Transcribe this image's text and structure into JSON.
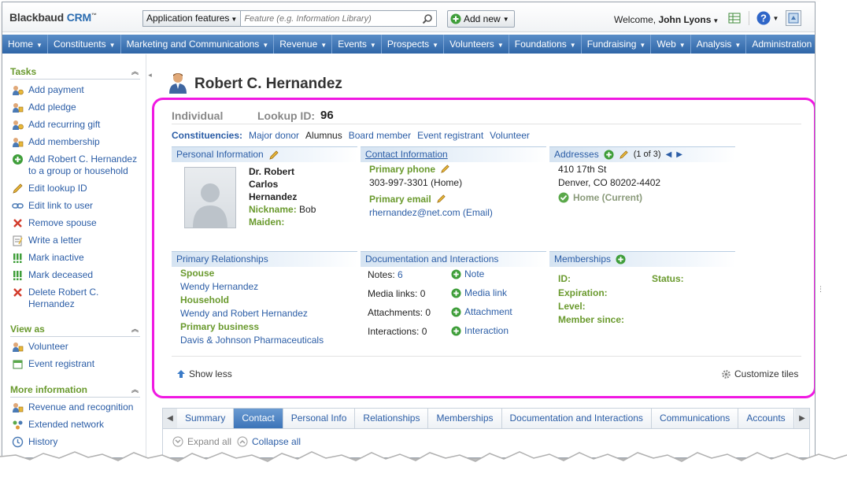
{
  "header": {
    "logo_brand": "Blackbaud",
    "logo_product": "CRM",
    "logo_tm": "™",
    "search_scope": "Application features",
    "search_placeholder": "Feature (e.g. Information Library)",
    "add_new": "Add new",
    "welcome_prefix": "Welcome,",
    "user_name": "John Lyons"
  },
  "nav": {
    "items": [
      "Home",
      "Constituents",
      "Marketing and Communications",
      "Revenue",
      "Events",
      "Prospects",
      "Volunteers",
      "Foundations",
      "Fundraising",
      "Web",
      "Analysis",
      "Administration"
    ],
    "more": "»"
  },
  "sidebar": {
    "tasks_title": "Tasks",
    "tasks": [
      {
        "label": "Add payment",
        "icon": "payment-icon"
      },
      {
        "label": "Add pledge",
        "icon": "pledge-icon"
      },
      {
        "label": "Add recurring gift",
        "icon": "recurring-gift-icon"
      },
      {
        "label": "Add membership",
        "icon": "membership-icon"
      },
      {
        "label": "Add Robert C. Hernandez to a group or household",
        "icon": "add-green-icon"
      },
      {
        "label": "Edit lookup ID",
        "icon": "pencil-icon"
      },
      {
        "label": "Edit link to user",
        "icon": "link-icon"
      },
      {
        "label": "Remove spouse",
        "icon": "remove-red-x-icon"
      },
      {
        "label": "Write a letter",
        "icon": "letter-icon"
      },
      {
        "label": "Mark inactive",
        "icon": "mark-inactive-icon"
      },
      {
        "label": "Mark deceased",
        "icon": "mark-deceased-icon"
      },
      {
        "label": "Delete Robert C. Hernandez",
        "icon": "delete-red-x-icon"
      }
    ],
    "viewas_title": "View as",
    "viewas": [
      {
        "label": "Volunteer",
        "icon": "volunteer-icon"
      },
      {
        "label": "Event registrant",
        "icon": "event-registrant-icon"
      }
    ],
    "moreinfo_title": "More information",
    "moreinfo": [
      {
        "label": "Revenue and recognition",
        "icon": "revenue-icon"
      },
      {
        "label": "Extended network",
        "icon": "network-icon"
      },
      {
        "label": "History",
        "icon": "history-icon"
      }
    ]
  },
  "record": {
    "name": "Robert C. Hernandez",
    "type": "Individual",
    "lookup_label": "Lookup ID:",
    "lookup_id": "96",
    "constituencies_label": "Constituencies:",
    "constituencies": [
      "Major donor",
      "Alumnus",
      "Board member",
      "Event registrant",
      "Volunteer"
    ]
  },
  "tiles": {
    "personal": {
      "title": "Personal Information",
      "name_line1": "Dr. Robert",
      "name_line2": "Carlos",
      "name_line3": "Hernandez",
      "nickname_label": "Nickname:",
      "nickname": "Bob",
      "maiden_label": "Maiden:"
    },
    "contact": {
      "title": "Contact Information",
      "phone_label": "Primary phone",
      "phone": "303-997-3301 (Home)",
      "email_label": "Primary email",
      "email": "rhernandez@net.com (Email)"
    },
    "addresses": {
      "title": "Addresses",
      "paging": "(1 of 3)",
      "line1": "410 17th St",
      "line2": "Denver, CO 80202-4402",
      "type": "Home (Current)"
    },
    "relationships": {
      "title": "Primary Relationships",
      "spouse_label": "Spouse",
      "spouse": "Wendy Hernandez",
      "household_label": "Household",
      "household": "Wendy and Robert Hernandez",
      "business_label": "Primary business",
      "business": "Davis & Johnson Pharmaceuticals"
    },
    "documentation": {
      "title": "Documentation and Interactions",
      "notes_label": "Notes:",
      "notes_count": "6",
      "media_label": "Media links:",
      "media_count": "0",
      "attach_label": "Attachments:",
      "attach_count": "0",
      "inter_label": "Interactions:",
      "inter_count": "0",
      "add_note": "Note",
      "add_media": "Media link",
      "add_attach": "Attachment",
      "add_inter": "Interaction"
    },
    "memberships": {
      "title": "Memberships",
      "id_label": "ID:",
      "status_label": "Status:",
      "expiration_label": "Expiration:",
      "level_label": "Level:",
      "since_label": "Member since:"
    }
  },
  "card_footer": {
    "show_less": "Show less",
    "customize": "Customize tiles"
  },
  "tabs": {
    "items": [
      "Summary",
      "Contact",
      "Personal Info",
      "Relationships",
      "Memberships",
      "Documentation and Interactions",
      "Communications",
      "Accounts"
    ],
    "active": "Contact",
    "expand_all": "Expand all",
    "collapse_all": "Collapse all"
  },
  "colors": {
    "nav_blue": "#2f66a8",
    "link_blue": "#2b5da6",
    "label_green": "#6a9a2e",
    "highlight_magenta": "#f018e2"
  }
}
